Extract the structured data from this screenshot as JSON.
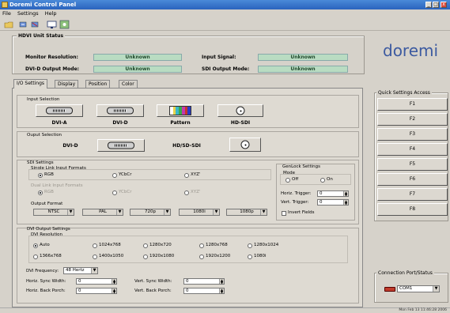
{
  "window": {
    "title": "Doremi Control Panel",
    "title_color": "#2a63bd",
    "controls": [
      "_",
      "□",
      "x"
    ]
  },
  "menu": [
    "File",
    "Settings",
    "Help"
  ],
  "toolbar": {
    "icons": [
      "open-folder-icon",
      "connect-icon",
      "disconnect-icon",
      "monitor-icon",
      "settings-icon"
    ]
  },
  "unit_status": {
    "title": "HDVI Unit Status",
    "monitor_resolution_label": "Monitor Resolution:",
    "monitor_resolution": "Unknown",
    "dvid_output_mode_label": "DVI-D Output Mode:",
    "dvid_output_mode": "Unknown",
    "input_signal_label": "Input Signal:",
    "input_signal": "Unknown",
    "sdi_output_mode_label": "SDI Output Mode:",
    "sdi_output_mode": "Unknown",
    "value_bg": "#b9dcc2"
  },
  "logo": "doremi",
  "tabs": [
    {
      "label": "I/O Settings",
      "active": true
    },
    {
      "label": "Display",
      "active": false
    },
    {
      "label": "Position",
      "active": false
    },
    {
      "label": "Color",
      "active": false
    }
  ],
  "input_selection": {
    "title": "Input Selection",
    "inputs": [
      "DVI-A",
      "DVI-D",
      "Pattern",
      "HD-SDI"
    ]
  },
  "output_selection": {
    "title": "Ouput Selection",
    "outputs": [
      "DVI-D",
      "HD/SD-SDI"
    ]
  },
  "sdi_settings": {
    "title": "SDI Settings",
    "single_link_title": "Single Link Input Formats",
    "single_link": [
      {
        "label": "RGB",
        "selected": true
      },
      {
        "label": "YCbCr",
        "selected": false
      },
      {
        "label": "XYZ'",
        "selected": false
      }
    ],
    "dual_link_title": "Dual Link Input Formats",
    "dual_link": [
      {
        "label": "RGB",
        "selected": true
      },
      {
        "label": "YCbCr",
        "selected": false
      },
      {
        "label": "XYZ'",
        "selected": false
      }
    ],
    "output_format_title": "Output Format",
    "output_formats": [
      "NTSC",
      "PAL",
      "720p",
      "1080i",
      "1080p"
    ]
  },
  "genlock": {
    "title": "GenLock Settings",
    "mode_title": "Mode",
    "mode_off": "Off",
    "mode_on": "On",
    "horiz_trigger_label": "Horiz. Trigger:",
    "horiz_trigger": "0",
    "vert_trigger_label": "Vert. Trigger:",
    "vert_trigger": "0",
    "invert_fields": "Invert Fields"
  },
  "dvi_output": {
    "title": "DVI Output Settings",
    "resolution_title": "DVI Resolution",
    "resolutions": [
      {
        "label": "Auto",
        "selected": true
      },
      {
        "label": "1024x768",
        "selected": false
      },
      {
        "label": "1280x720",
        "selected": false
      },
      {
        "label": "1280x768",
        "selected": false
      },
      {
        "label": "1280x1024",
        "selected": false
      },
      {
        "label": "1366x768",
        "selected": false
      },
      {
        "label": "1400x1050",
        "selected": false
      },
      {
        "label": "1920x1080",
        "selected": false
      },
      {
        "label": "1920x1200",
        "selected": false
      },
      {
        "label": "1080i",
        "selected": false
      }
    ],
    "frequency_label": "DVI Frequency:",
    "frequency": "48 Hertz",
    "horiz_sync_width_label": "Horiz. Sync Width:",
    "horiz_sync_width": "0",
    "horiz_back_porch_label": "Horiz. Back Porch:",
    "horiz_back_porch": "0",
    "vert_sync_width_label": "Vert. Sync Width:",
    "vert_sync_width": "0",
    "vert_back_porch_label": "Vert. Back Porch:",
    "vert_back_porch": "0"
  },
  "quick_settings": {
    "title": "Quick Settings Access",
    "buttons": [
      "F1",
      "F2",
      "F3",
      "F4",
      "F5",
      "F6",
      "F7",
      "F8"
    ]
  },
  "connection": {
    "title": "Connection Port/Status",
    "port": "COM1"
  },
  "statusbar": {
    "datetime": "Mon Feb 13 11:46:28 2006"
  }
}
